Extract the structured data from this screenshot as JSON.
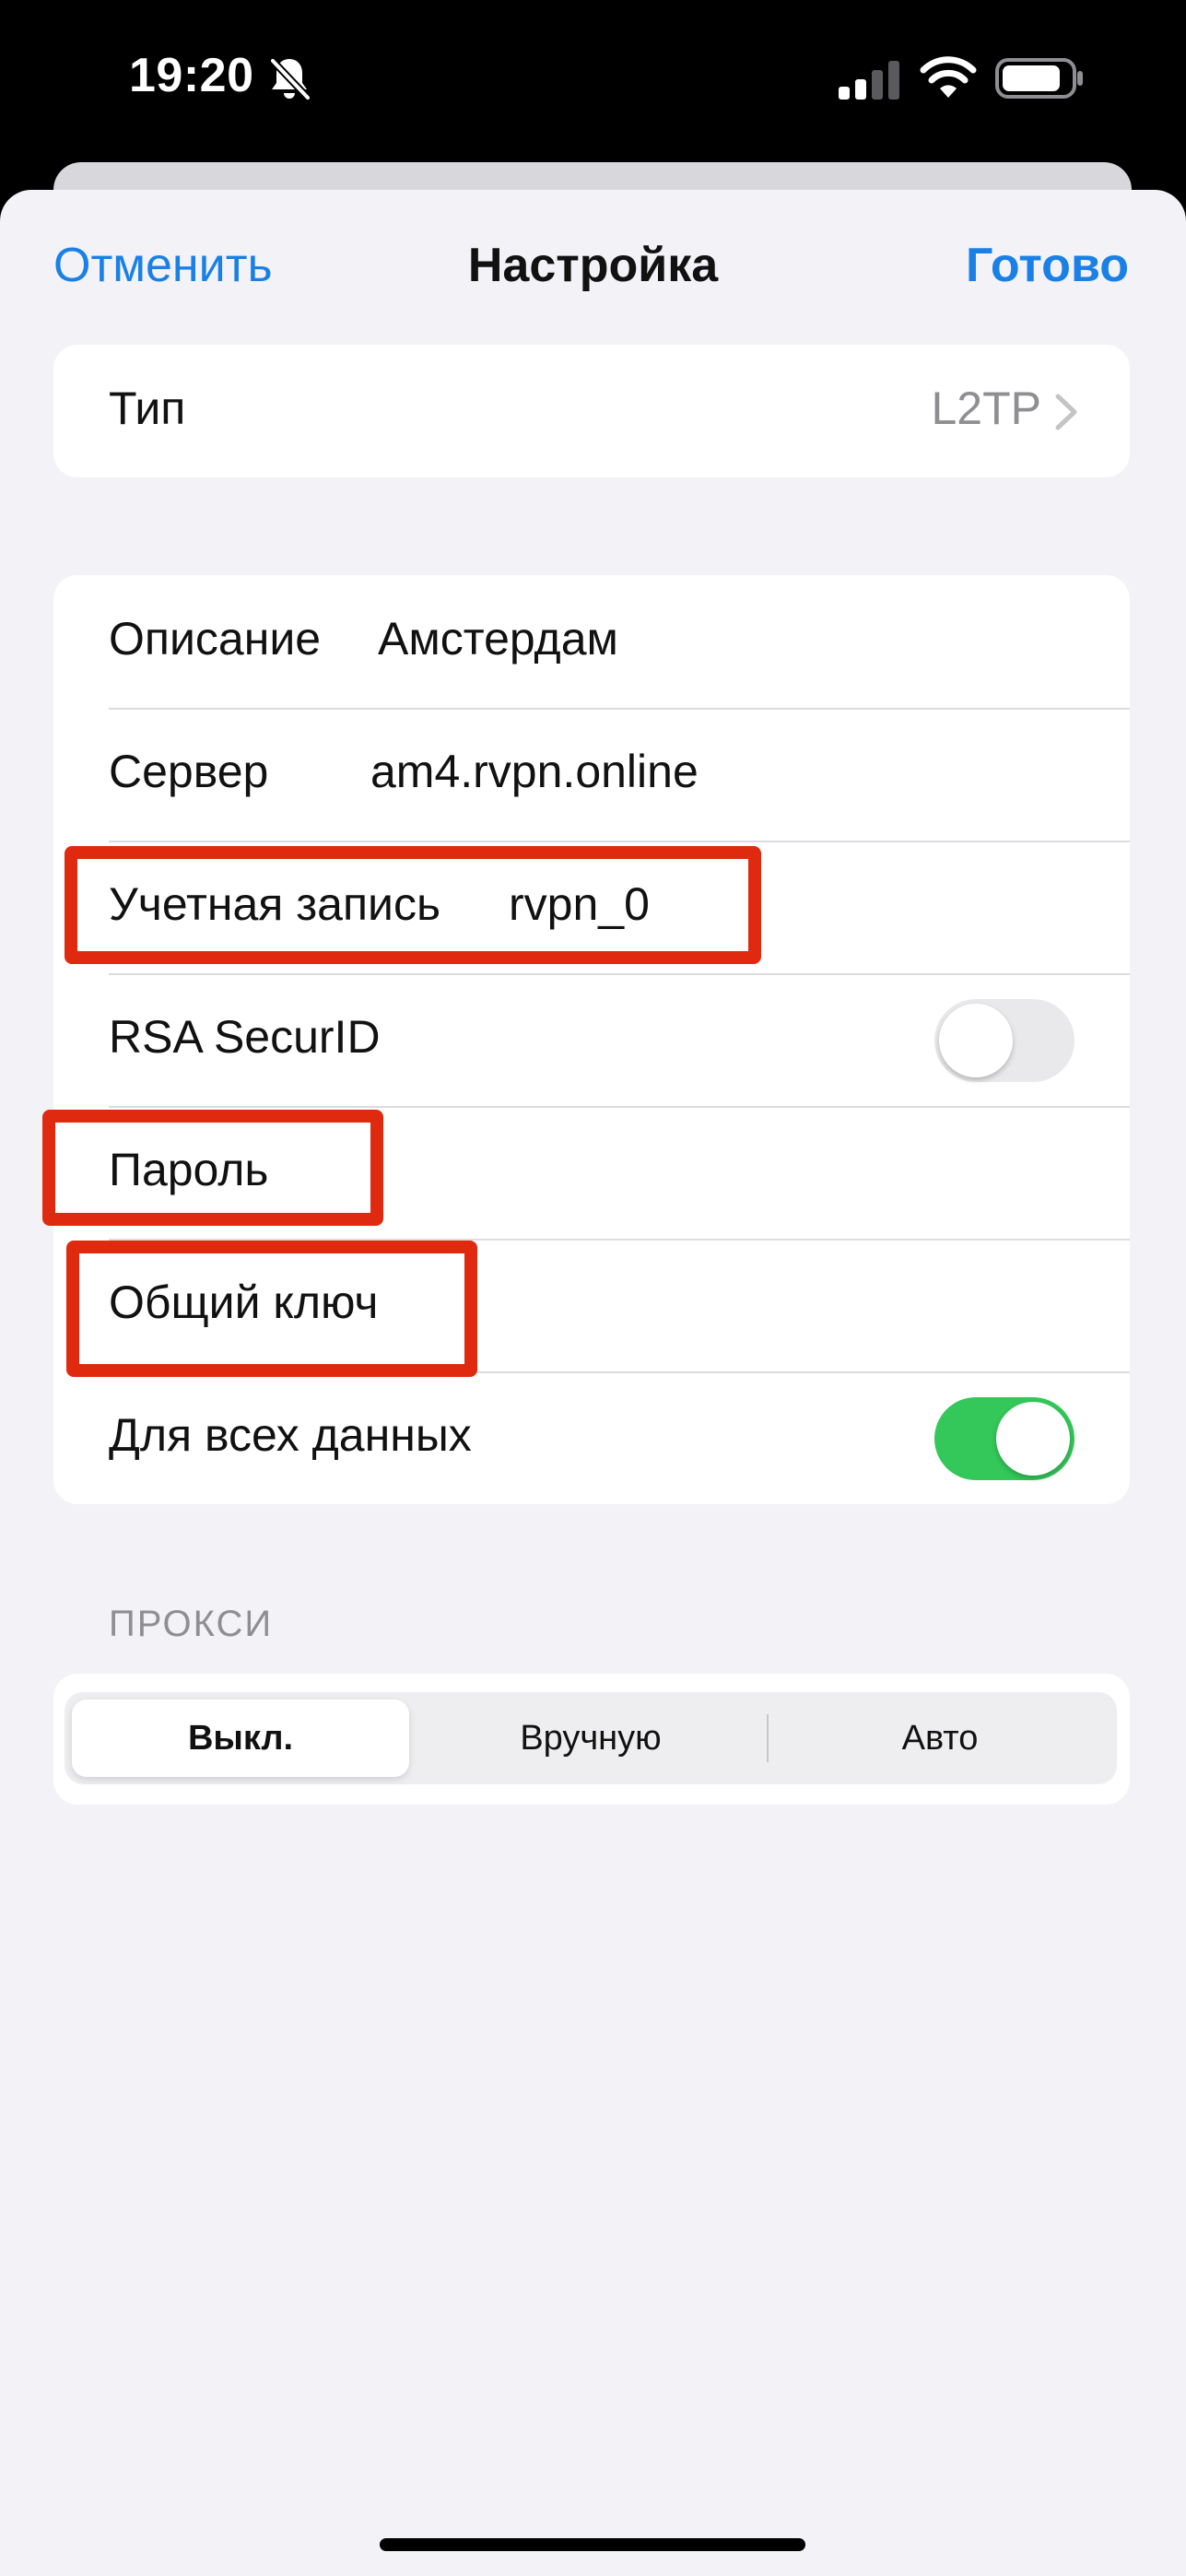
{
  "status_bar": {
    "time": "19:20",
    "icons": [
      "bell-slash-icon",
      "cellular-signal-icon",
      "wifi-icon",
      "battery-icon"
    ]
  },
  "nav": {
    "cancel": "Отменить",
    "title": "Настройка",
    "done": "Готово"
  },
  "type_row": {
    "label": "Тип",
    "value": "L2TP"
  },
  "fields": {
    "description": {
      "label": "Описание",
      "value": "Амстердам"
    },
    "server": {
      "label": "Сервер",
      "value": "am4.rvpn.online"
    },
    "account": {
      "label": "Учетная запись",
      "value": "rvpn_0"
    },
    "rsa": {
      "label": "RSA SecurID",
      "enabled": false
    },
    "password": {
      "label": "Пароль",
      "value": ""
    },
    "shared_secret": {
      "label": "Общий ключ",
      "value": ""
    },
    "send_all": {
      "label": "Для всех данных",
      "enabled": true
    }
  },
  "proxy": {
    "header": "ПРОКСИ",
    "options": [
      "Выкл.",
      "Вручную",
      "Авто"
    ],
    "selected": "Выкл."
  },
  "colors": {
    "accent": "#1a80e6",
    "toggle_on": "#34c759",
    "highlight": "#e02a10",
    "background": "#f2f2f7"
  }
}
